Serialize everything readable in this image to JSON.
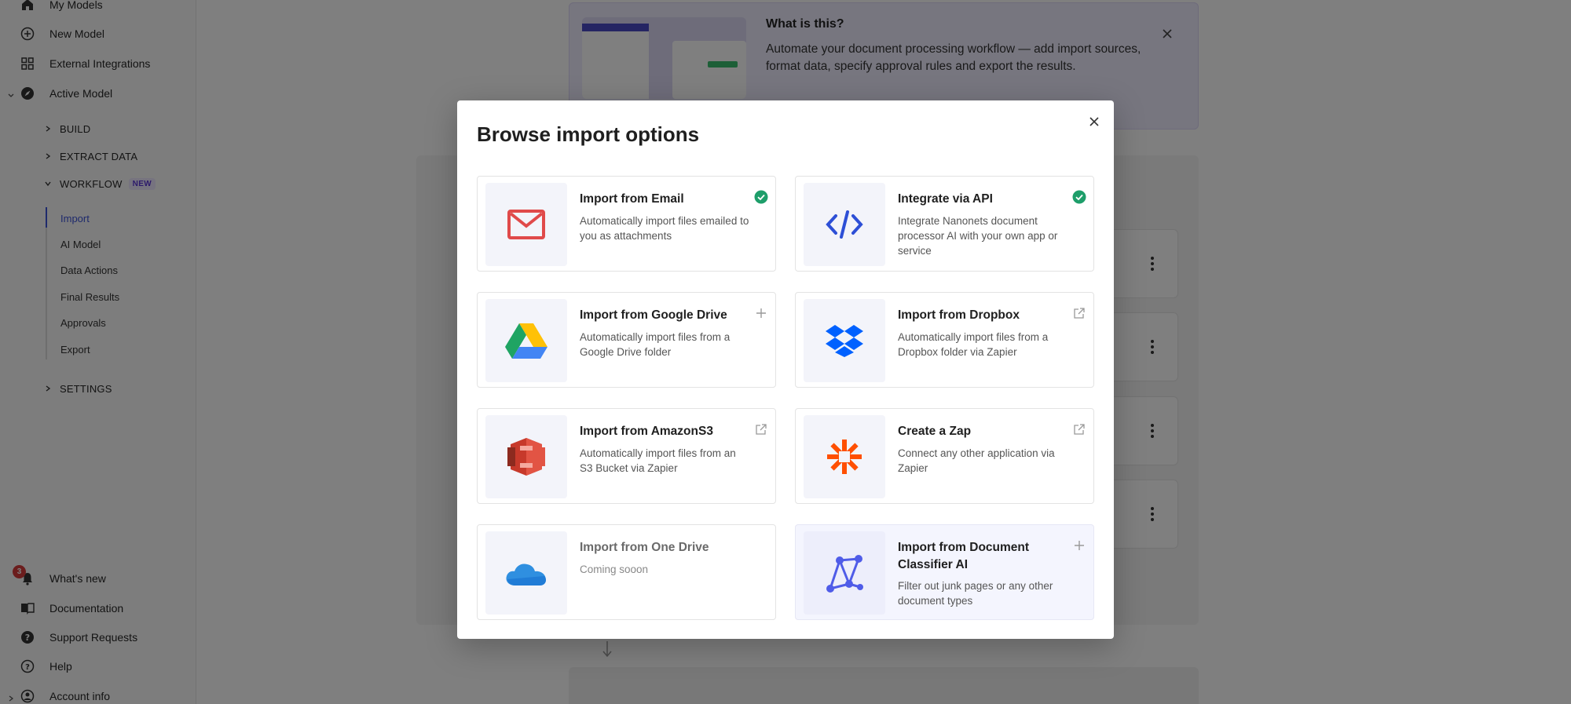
{
  "sidebar": {
    "top_items": [
      {
        "label": "My Models",
        "icon": "home-icon"
      },
      {
        "label": "New Model",
        "icon": "plus-circle-icon"
      },
      {
        "label": "External Integrations",
        "icon": "grid-icon"
      },
      {
        "label": "Active Model",
        "icon": "compass-icon"
      }
    ],
    "sections": {
      "build": "BUILD",
      "extract": "EXTRACT DATA",
      "workflow": "WORKFLOW",
      "workflow_badge": "NEW",
      "settings": "SETTINGS"
    },
    "workflow_items": [
      "Import",
      "AI Model",
      "Data Actions",
      "Final Results",
      "Approvals",
      "Export"
    ],
    "bottom_items": [
      {
        "label": "What's new",
        "icon": "bell-icon"
      },
      {
        "label": "Documentation",
        "icon": "book-icon"
      },
      {
        "label": "Support Requests",
        "icon": "question-circle-icon"
      },
      {
        "label": "Help",
        "icon": "help-icon"
      },
      {
        "label": "Account info",
        "icon": "user-icon"
      }
    ],
    "notification_count": "3"
  },
  "info_card": {
    "title": "What is this?",
    "text": "Automate your document processing workflow — add import sources, format data, specify approval rules and export the results."
  },
  "modal": {
    "title": "Browse import options",
    "options": [
      {
        "title": "Import from Email",
        "desc": "Automatically import files emailed to you as attachments",
        "status": "check"
      },
      {
        "title": "Integrate via API",
        "desc": "Integrate Nanonets document processor AI with your own app or service",
        "status": "check"
      },
      {
        "title": "Import from Google Drive",
        "desc": "Automatically import files from a Google Drive folder",
        "status": "add"
      },
      {
        "title": "Import from Dropbox",
        "desc": "Automatically import files from a Dropbox folder via Zapier",
        "status": "external"
      },
      {
        "title": "Import from AmazonS3",
        "desc": "Automatically import files from an S3 Bucket via Zapier",
        "status": "external"
      },
      {
        "title": "Create a Zap",
        "desc": "Connect any other application via Zapier",
        "status": "external"
      },
      {
        "title": "Import from One Drive",
        "desc": "Coming sooon",
        "status": "none"
      },
      {
        "title": "Import from Document Classifier AI",
        "desc": "Filter out junk pages or any other document types",
        "status": "add"
      }
    ]
  },
  "colors": {
    "accent": "#3d54d9",
    "check": "#1e9e6a",
    "gmail_red": "#e04a4a",
    "zapier": "#ff4f00"
  }
}
